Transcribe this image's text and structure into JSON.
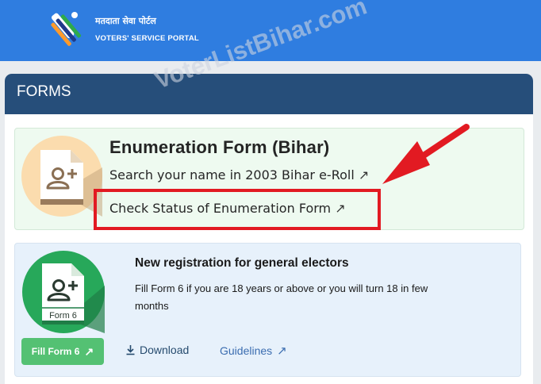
{
  "header": {
    "title_hindi": "मतदाता सेवा पोर्टल",
    "title_english": "VOTERS' SERVICE PORTAL"
  },
  "watermark": "VoterListBihar.com",
  "forms": {
    "title": "FORMS"
  },
  "enumeration_card": {
    "title": "Enumeration Form (Bihar)",
    "search_link": "Search your name in 2003 Bihar e-Roll",
    "status_link": "Check Status of Enumeration Form",
    "icon": "user-add-icon"
  },
  "form6_card": {
    "icon_label": "Form 6",
    "title": "New registration for general electors",
    "description": "Fill Form 6 if you are 18 years or above or you will turn 18 in few months",
    "fill_button": "Fill Form 6",
    "download_label": "Download",
    "guidelines_label": "Guidelines"
  },
  "colors": {
    "header_bg": "#2f7de0",
    "forms_header_bg": "#264e7a",
    "highlight_red": "#e21a22",
    "form6_green": "#27a85a"
  }
}
